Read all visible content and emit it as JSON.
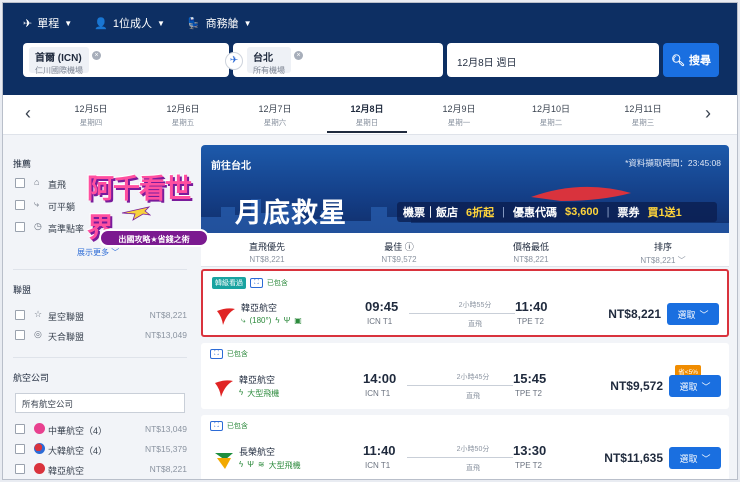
{
  "search": {
    "trip_type": "單程",
    "passengers": "1位成人",
    "cabin": "商務艙",
    "from": {
      "code": "首爾 (ICN)",
      "airport": "仁川國際機場"
    },
    "to": {
      "code": "台北",
      "airport": "所有機場"
    },
    "date": "12月8日 週日",
    "search_label": "搜尋"
  },
  "dates": [
    {
      "date": "12月5日",
      "day": "星期四"
    },
    {
      "date": "12月6日",
      "day": "星期五"
    },
    {
      "date": "12月7日",
      "day": "星期六"
    },
    {
      "date": "12月8日",
      "day": "星期日",
      "active": true
    },
    {
      "date": "12月9日",
      "day": "星期一"
    },
    {
      "date": "12月10日",
      "day": "星期二"
    },
    {
      "date": "12月11日",
      "day": "星期三"
    }
  ],
  "sidebar": {
    "recommended_title": "推薦",
    "recommended": [
      {
        "label": "直飛",
        "icon": "seat-icon"
      },
      {
        "label": "可平躺",
        "icon": "flat-bed-icon"
      },
      {
        "label": "高準點率",
        "icon": "clock-icon"
      }
    ],
    "show_more": "展示更多",
    "alliance_title": "聯盟",
    "alliances": [
      {
        "label": "星空聯盟",
        "price": "NT$8,221",
        "icon": "star-icon"
      },
      {
        "label": "天合聯盟",
        "price": "NT$13,049",
        "icon": "skyteam-icon"
      }
    ],
    "airline_title": "航空公司",
    "airline_select": "所有航空公司",
    "airlines": [
      {
        "label": "中華航空（4）",
        "price": "NT$13,049",
        "color": "#e8418f"
      },
      {
        "label": "大韓航空（4）",
        "price": "NT$15,379",
        "color": "#2c6bd6"
      },
      {
        "label": "韓亞航空",
        "price": "NT$8,221",
        "color": "#d9333d"
      }
    ]
  },
  "promo": {
    "title": "阿千看世界",
    "tagline": "出國攻略★省錢之術"
  },
  "banner": {
    "destination": "前往台北",
    "fetched": "*資料擷取時間：23:45:08",
    "title": "月底救星",
    "strip": [
      "機票｜飯店",
      "6折起",
      "優惠代碼",
      "$3,600",
      "票券",
      "買1送1"
    ]
  },
  "sort": [
    {
      "label": "直飛優先",
      "price": "NT$8,221"
    },
    {
      "label": "最佳",
      "price": "NT$9,572"
    },
    {
      "label": "價格最低",
      "price": "NT$8,221"
    },
    {
      "label": "排序",
      "price": "NT$8,221"
    }
  ],
  "flights": [
    {
      "tag": "韓級看過",
      "baggage": "已包含",
      "airline": "韓亞航空",
      "amenities": "(180°)",
      "dep_time": "09:45",
      "dep_ap": "ICN T1",
      "duration": "2小時55分",
      "stops": "直飛",
      "arr_time": "11:40",
      "arr_ap": "TPE T2",
      "price": "NT$8,221",
      "select": "選取",
      "logo_color": "#e02424",
      "selected": true
    },
    {
      "baggage": "已包含",
      "airline": "韓亞航空",
      "amenities": "大型飛機",
      "dep_time": "14:00",
      "dep_ap": "ICN T1",
      "duration": "2小時45分",
      "stops": "直飛",
      "arr_time": "15:45",
      "arr_ap": "TPE T2",
      "price": "NT$9,572",
      "select": "選取",
      "discount": "省<5%",
      "logo_color": "#e02424"
    },
    {
      "baggage": "已包含",
      "airline": "長榮航空",
      "amenities": "大型飛機",
      "dep_time": "11:40",
      "dep_ap": "ICN T1",
      "duration": "2小時50分",
      "stops": "直飛",
      "arr_time": "13:30",
      "arr_ap": "TPE T2",
      "price": "NT$11,635",
      "select": "選取",
      "logo_color": "#1e8e3e"
    }
  ]
}
